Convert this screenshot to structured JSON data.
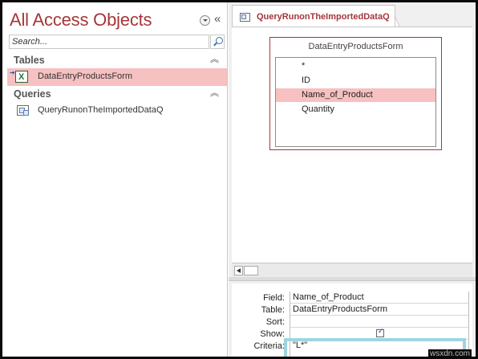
{
  "nav": {
    "title": "All Access Objects",
    "search_placeholder": "Search...",
    "groups": [
      {
        "label": "Tables",
        "items": [
          {
            "label": "DataEntryProductsForm",
            "selected": true,
            "icon": "linked-excel-table-icon"
          }
        ]
      },
      {
        "label": "Queries",
        "items": [
          {
            "label": "QueryRunonTheImportedDataQ",
            "selected": false,
            "icon": "query-icon"
          }
        ]
      }
    ]
  },
  "document": {
    "tab_label": "QueryRunonTheImportedDataQ",
    "table_box": {
      "title": "DataEntryProductsForm",
      "fields": [
        "*",
        "ID",
        "Name_of_Product",
        "Quantity"
      ],
      "highlighted_field": "Name_of_Product"
    },
    "grid": {
      "row_labels": [
        "Field:",
        "Table:",
        "Sort:",
        "Show:",
        "Criteria:"
      ],
      "column": {
        "field": "Name_of_Product",
        "table": "DataEntryProductsForm",
        "sort": "",
        "show": true,
        "criteria": "\"L*\""
      }
    }
  },
  "watermark": "wsxdn.com",
  "colors": {
    "accent": "#a4373a",
    "selection": "#f7c0c1",
    "focus": "#9fd4df"
  }
}
